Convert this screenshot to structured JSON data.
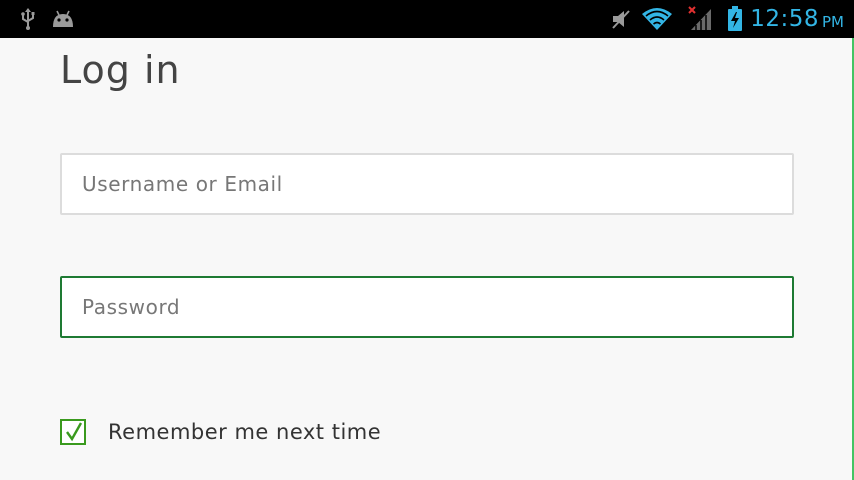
{
  "status_bar": {
    "time": "12:58",
    "ampm": "PM",
    "icons": [
      "usb-icon",
      "android-icon",
      "mute-icon",
      "wifi-icon",
      "signal-icon",
      "battery-charging-icon"
    ],
    "colors": {
      "background": "#000000",
      "clock": "#33b5e5",
      "icons": "#9a9a9a",
      "wifi": "#33b5e5",
      "no_signal_x": "#e03030"
    }
  },
  "login": {
    "title": "Log in",
    "username_placeholder": "Username or Email",
    "password_placeholder": "Password",
    "remember_label": "Remember me next time",
    "remember_checked": true
  },
  "colors": {
    "page_background": "#f8f8f8",
    "focused_border": "#1e7a33",
    "checkbox": "#3a9a1e",
    "edge_accent": "#43c463"
  }
}
